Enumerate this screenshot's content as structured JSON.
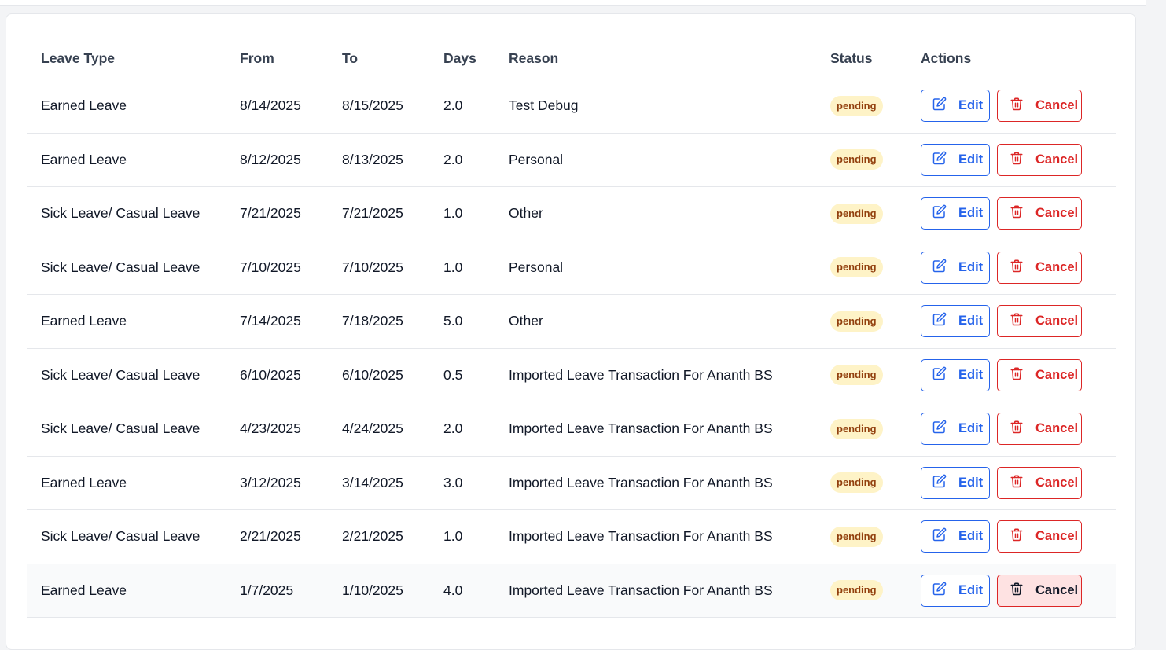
{
  "table": {
    "headers": {
      "leave_type": "Leave Type",
      "from": "From",
      "to": "To",
      "days": "Days",
      "reason": "Reason",
      "status": "Status",
      "actions": "Actions"
    },
    "rows": [
      {
        "leave_type": "Earned Leave",
        "from": "8/14/2025",
        "to": "8/15/2025",
        "days": "2.0",
        "reason": "Test Debug",
        "status": "pending"
      },
      {
        "leave_type": "Earned Leave",
        "from": "8/12/2025",
        "to": "8/13/2025",
        "days": "2.0",
        "reason": "Personal",
        "status": "pending"
      },
      {
        "leave_type": "Sick Leave/ Casual Leave",
        "from": "7/21/2025",
        "to": "7/21/2025",
        "days": "1.0",
        "reason": "Other",
        "status": "pending"
      },
      {
        "leave_type": "Sick Leave/ Casual Leave",
        "from": "7/10/2025",
        "to": "7/10/2025",
        "days": "1.0",
        "reason": "Personal",
        "status": "pending"
      },
      {
        "leave_type": "Earned Leave",
        "from": "7/14/2025",
        "to": "7/18/2025",
        "days": "5.0",
        "reason": "Other",
        "status": "pending"
      },
      {
        "leave_type": "Sick Leave/ Casual Leave",
        "from": "6/10/2025",
        "to": "6/10/2025",
        "days": "0.5",
        "reason": "Imported Leave Transaction For Ananth BS",
        "status": "pending"
      },
      {
        "leave_type": "Sick Leave/ Casual Leave",
        "from": "4/23/2025",
        "to": "4/24/2025",
        "days": "2.0",
        "reason": "Imported Leave Transaction For Ananth BS",
        "status": "pending"
      },
      {
        "leave_type": "Earned Leave",
        "from": "3/12/2025",
        "to": "3/14/2025",
        "days": "3.0",
        "reason": "Imported Leave Transaction For Ananth BS",
        "status": "pending"
      },
      {
        "leave_type": "Sick Leave/ Casual Leave",
        "from": "2/21/2025",
        "to": "2/21/2025",
        "days": "1.0",
        "reason": "Imported Leave Transaction For Ananth BS",
        "status": "pending"
      },
      {
        "leave_type": "Earned Leave",
        "from": "1/7/2025",
        "to": "1/10/2025",
        "days": "4.0",
        "reason": "Imported Leave Transaction For Ananth BS",
        "status": "pending"
      }
    ]
  },
  "actions": {
    "edit_label": "Edit",
    "cancel_label": "Cancel",
    "edit_icon": "edit-icon",
    "cancel_icon": "trash-icon"
  },
  "colors": {
    "edit": "#2563eb",
    "cancel": "#dc2626",
    "pending_bg": "#fef3c7",
    "pending_text": "#92400e"
  }
}
